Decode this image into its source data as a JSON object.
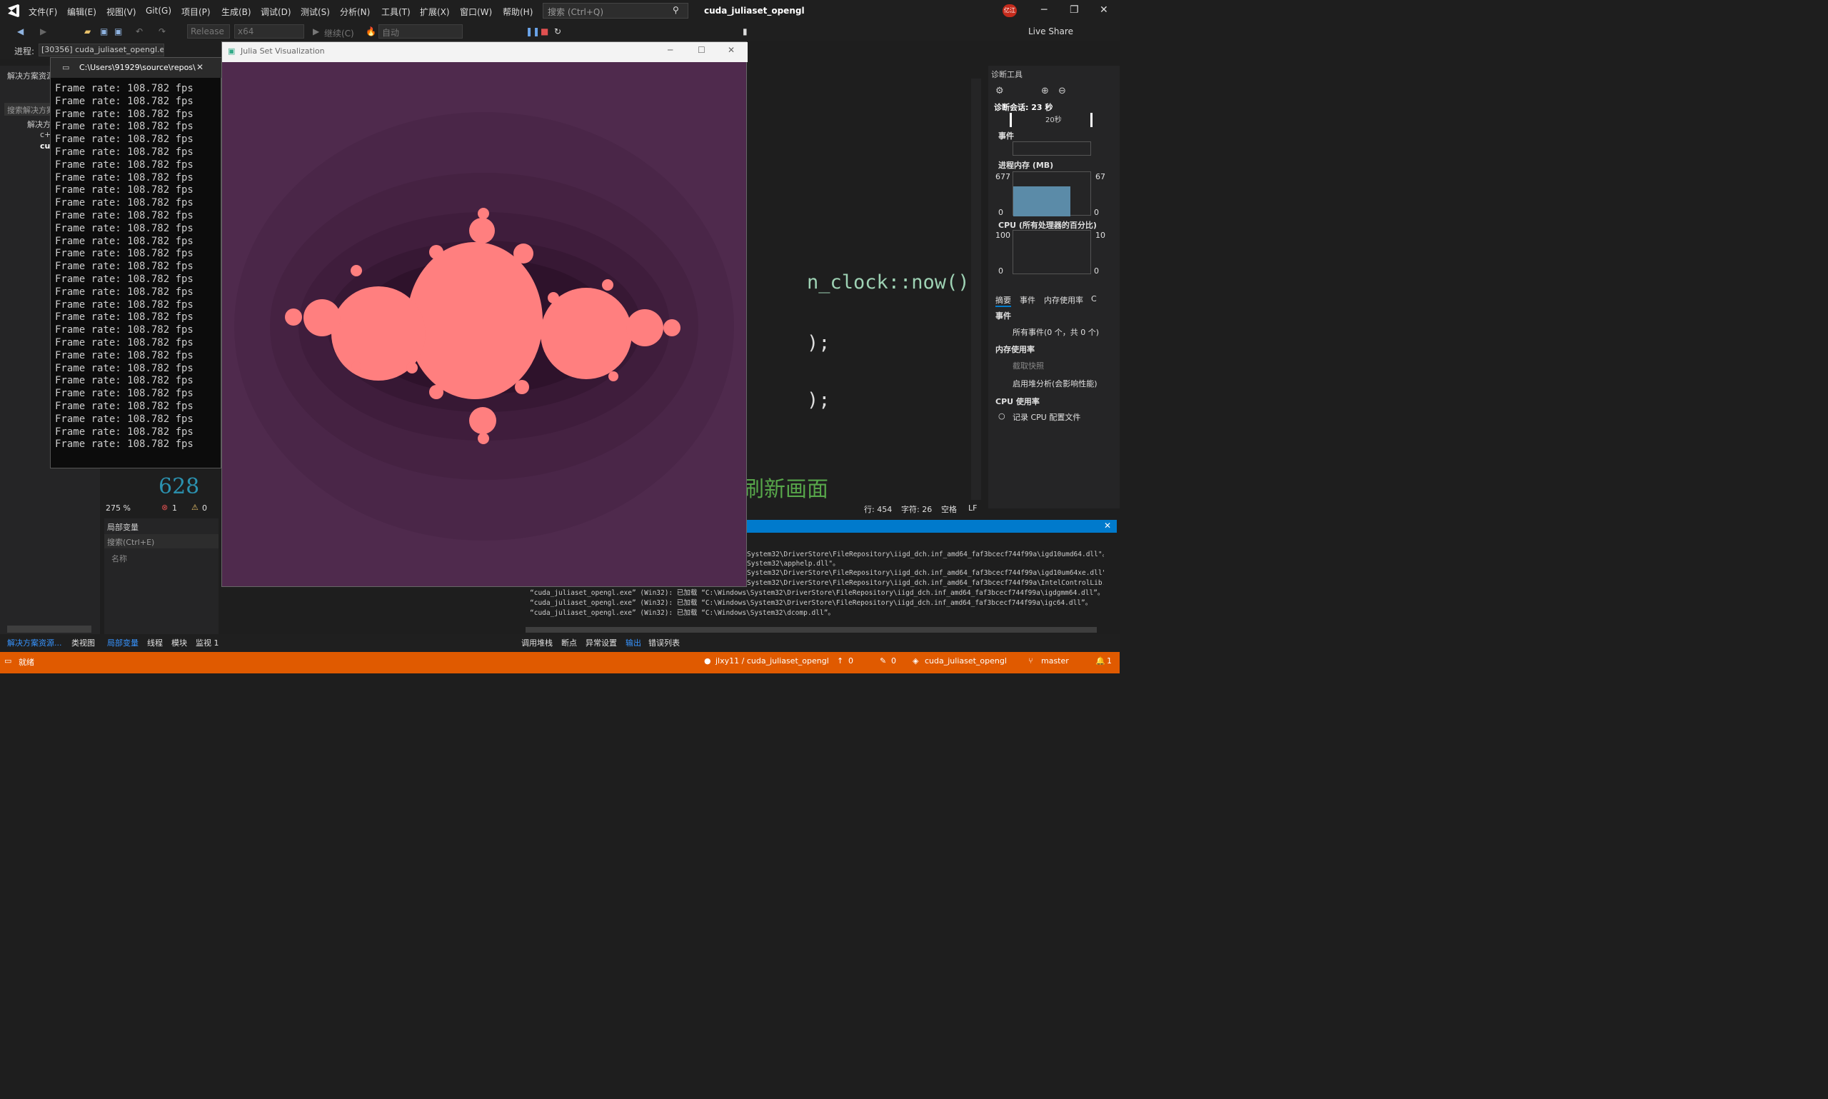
{
  "menu": [
    "文件(F)",
    "编辑(E)",
    "视图(V)",
    "Git(G)",
    "项目(P)",
    "生成(B)",
    "调试(D)",
    "测试(S)",
    "分析(N)",
    "工具(T)",
    "扩展(X)",
    "窗口(W)",
    "帮助(H)"
  ],
  "search_placeholder": "搜索 (Ctrl+Q)",
  "solution_title": "cuda_juliaset_opengl",
  "badge": "亿江",
  "toolbar": {
    "config": "Release",
    "platform": "x64",
    "continue": "继续(C)",
    "auto": "自动",
    "live_share": "Live Share"
  },
  "process": {
    "label": "进程:",
    "value": "[30356] cuda_juliaset_opengl.e"
  },
  "solution_panel": {
    "title": "解决方案资源",
    "search": "搜索解决方案",
    "root": "解决方",
    "items": [
      "c+",
      "cu"
    ]
  },
  "console": {
    "title": "C:\\Users\\91929\\source\\repos\\",
    "line": "Frame rate: 108.782 fps",
    "count": 29
  },
  "julia": {
    "title": "Julia Set Visualization",
    "bg": "#4f2a4d",
    "fill": "#ff7f7f"
  },
  "code": {
    "line1": "n_clock::now()",
    "line2": ");",
    "line3": ");",
    "comment": "刷新画面",
    "line_num": "628"
  },
  "editor_status": {
    "zoom": "275 %",
    "errors": "1",
    "warnings": "0",
    "line": "行: 454",
    "char": "字符: 26",
    "space": "空格",
    "eol": "LF"
  },
  "locals": {
    "title": "局部变量",
    "search": "搜索(Ctrl+E)",
    "col": "名称"
  },
  "diag": {
    "title": "诊断工具",
    "session": "诊断会话: 23 秒",
    "time": "20秒",
    "events": "事件",
    "mem": "进程内存 (MB)",
    "mem_max": "677",
    "mem_min": "0",
    "mem_max_r": "67",
    "mem_min_r": "0",
    "cpu": "CPU (所有处理器的百分比)",
    "cpu_max": "100",
    "cpu_min": "0",
    "cpu_max_r": "10",
    "cpu_min_r": "0",
    "tabs": [
      "摘要",
      "事件",
      "内存使用率",
      "C"
    ],
    "sec_events": "事件",
    "all_events": "所有事件(0 个，共 0 个)",
    "sec_mem": "内存使用率",
    "snapshot": "截取快照",
    "heap": "启用堆分析(会影响性能)",
    "sec_cpu": "CPU 使用率",
    "cpu_profile": "记录 CPU 配置文件"
  },
  "output_lines": [
    "System32\\DriverStore\\FileRepository\\iigd_dch.inf_amd64_faf3bcecf744f99a\\igd10umd64.dll\"。",
    "System32\\apphelp.dll\"。",
    "System32\\DriverStore\\FileRepository\\iigd_dch.inf_amd64_faf3bcecf744f99a\\igd10um64xe.dll\"。",
    "System32\\DriverStore\\FileRepository\\iigd_dch.inf_amd64_faf3bcecf744f99a\\IntelControlLib.dll\"。",
    "“cuda_juliaset_opengl.exe” (Win32): 已加载 “C:\\Windows\\System32\\DriverStore\\FileRepository\\iigd_dch.inf_amd64_faf3bcecf744f99a\\igdgmm64.dll”。",
    "“cuda_juliaset_opengl.exe” (Win32): 已加载 “C:\\Windows\\System32\\DriverStore\\FileRepository\\iigd_dch.inf_amd64_faf3bcecf744f99a\\igc64.dll”。",
    "“cuda_juliaset_opengl.exe” (Win32): 已加载 “C:\\Windows\\System32\\dcomp.dll”。"
  ],
  "bottom_tabs_left": [
    "解决方案资源...",
    "类视图"
  ],
  "bottom_tabs_mid": [
    "局部变量",
    "线程",
    "模块",
    "监视 1"
  ],
  "bottom_tabs_right": [
    "调用堆栈",
    "断点",
    "异常设置",
    "输出",
    "错误列表"
  ],
  "status": {
    "ready": "就绪",
    "repo": "jlxy11 / cuda_juliaset_opengl",
    "up": "0",
    "pending": "0",
    "proj": "cuda_juliaset_opengl",
    "branch": "master",
    "bell": "1"
  }
}
